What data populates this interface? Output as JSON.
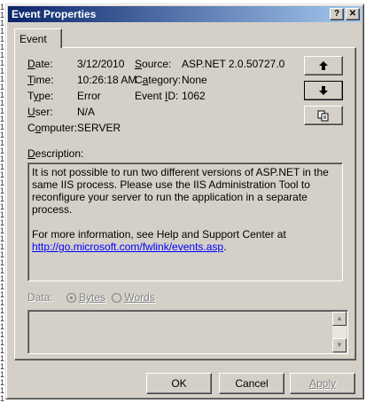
{
  "background_markers": [
    "1",
    "1",
    "1",
    "1",
    "1",
    "1",
    "1",
    "1",
    "1",
    "1",
    "1",
    "1",
    "1",
    "1",
    "1",
    "1",
    "1",
    "1",
    "1",
    "1",
    "1",
    "1",
    "1",
    "1",
    "1",
    "1",
    "1",
    "1",
    "1",
    "1",
    "1",
    "1",
    "1",
    "1",
    "1",
    "1",
    "1",
    "1",
    "1",
    "1",
    "1",
    "1",
    "1",
    "1",
    "1",
    "1",
    "1",
    "1",
    "1",
    "1"
  ],
  "window": {
    "title": "Event Properties",
    "help_glyph": "?",
    "close_glyph": "✕"
  },
  "tab": {
    "label": "Event"
  },
  "fields": {
    "date_label": "Date:",
    "date_value": "3/12/2010",
    "time_label": "Time:",
    "time_value": "10:26:18 AM",
    "type_label": "Type:",
    "type_value": "Error",
    "user_label": "User:",
    "user_value": "N/A",
    "computer_label": "Computer:",
    "computer_value": "SERVER",
    "source_label": "Source:",
    "source_value": "ASP.NET 2.0.50727.0",
    "category_label": "Category:",
    "category_value": "None",
    "eventid_label": "Event ID:",
    "eventid_value": "1062"
  },
  "nav": {
    "up_icon": "arrow-up-icon",
    "down_icon": "arrow-down-icon",
    "copy_icon": "copy-icon"
  },
  "description": {
    "label": "Description:",
    "paragraph1": "It is not possible to run two different versions of ASP.NET in the same IIS process. Please use the IIS Administration Tool to reconfigure your server to run the application in a separate process.",
    "paragraph2": "For more information, see Help and Support Center at",
    "link": "http://go.microsoft.com/fwlink/events.asp",
    "link_suffix": "."
  },
  "data": {
    "label": "Data:",
    "bytes_label": "Bytes",
    "words_label": "Words",
    "selected": "Bytes"
  },
  "buttons": {
    "ok": "OK",
    "cancel": "Cancel",
    "apply": "Apply"
  },
  "colors": {
    "face": "#d4d0c8",
    "title_start": "#0a246a",
    "title_end": "#a6caf0",
    "link": "#0000ff"
  }
}
